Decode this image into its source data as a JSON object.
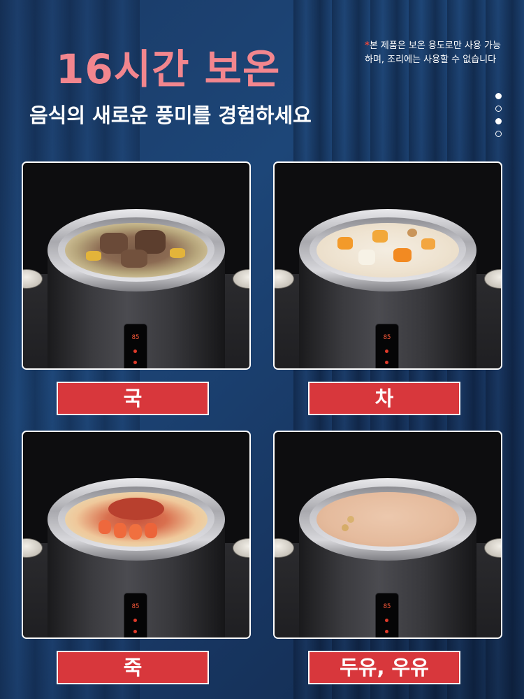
{
  "header": {
    "title": "16시간 보온",
    "subtitle": "음식의 새로운 풍미를 경험하세요",
    "note": "본 제품은 보온 용도로만 사용 가능하며, 조리에는 사용할 수 없습니다",
    "note_mark": "*"
  },
  "carousel": {
    "dots": [
      true,
      false,
      true,
      false
    ]
  },
  "panels": [
    {
      "id": "soup",
      "label": "국",
      "display": "85"
    },
    {
      "id": "tea",
      "label": "차",
      "display": "85"
    },
    {
      "id": "porridge",
      "label": "죽",
      "display": "85"
    },
    {
      "id": "milk",
      "label": "두유, 우유",
      "display": "85"
    }
  ],
  "colors": {
    "title": "#f2868e",
    "label_bg": "#d8373c",
    "background": "#1d4678"
  }
}
